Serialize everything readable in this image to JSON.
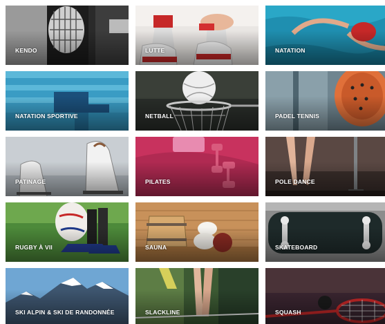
{
  "sports": [
    {
      "label": "KENDO",
      "icon": "kendo-photo"
    },
    {
      "label": "LUTTE",
      "icon": "lutte-photo"
    },
    {
      "label": "NATATION",
      "icon": "natation-photo"
    },
    {
      "label": "NATATION SPORTIVE",
      "icon": "natation-sportive-photo"
    },
    {
      "label": "NETBALL",
      "icon": "netball-photo"
    },
    {
      "label": "PADEL TENNIS",
      "icon": "padel-tennis-photo"
    },
    {
      "label": "PATINAGE",
      "icon": "patinage-photo"
    },
    {
      "label": "PILATES",
      "icon": "pilates-photo"
    },
    {
      "label": "POLE DANCE",
      "icon": "pole-dance-photo"
    },
    {
      "label": "RUGBY À VII",
      "icon": "rugby-photo"
    },
    {
      "label": "SAUNA",
      "icon": "sauna-photo"
    },
    {
      "label": "SKATEBOARD",
      "icon": "skateboard-photo"
    },
    {
      "label": "SKI ALPIN & SKI DE RANDONNÉE",
      "icon": "ski-photo"
    },
    {
      "label": "SLACKLINE",
      "icon": "slackline-photo"
    },
    {
      "label": "SQUASH",
      "icon": "squash-photo"
    }
  ]
}
